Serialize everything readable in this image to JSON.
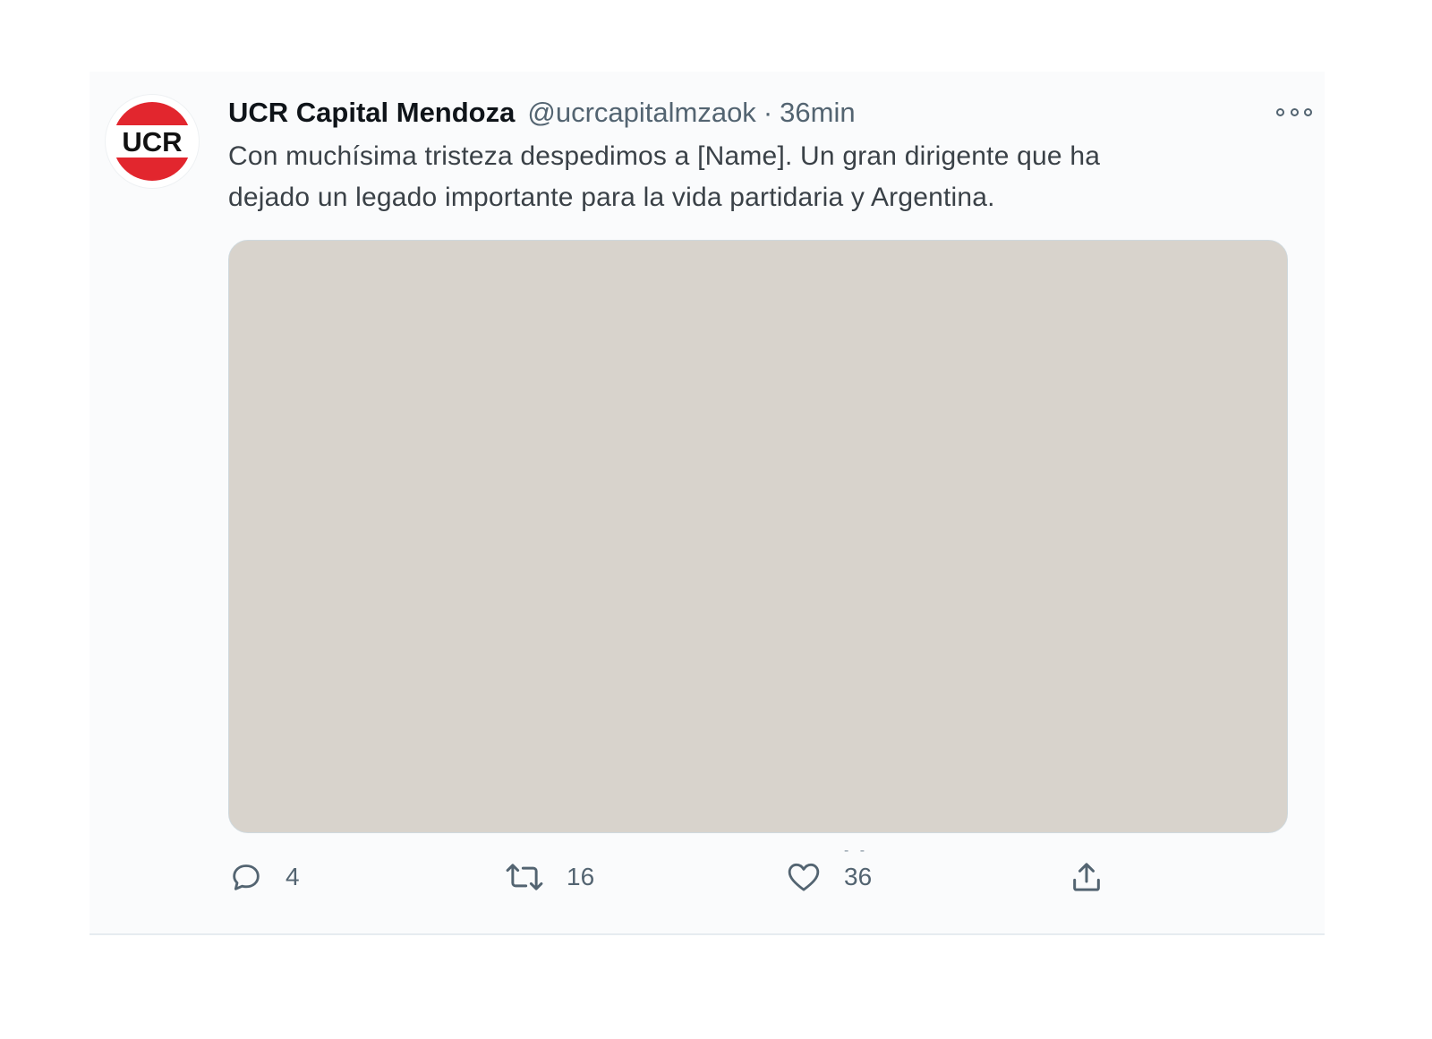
{
  "tweet": {
    "display_name": "UCR Capital Mendoza",
    "handle": "@ucrcapitalmzaok",
    "separator": "·",
    "time": "36min",
    "text_line_1": "Con muchísima tristeza despedimos a [Name]. Un gran dirigente que ha",
    "text_line_2": "dejado un legado importante para la vida partidaria y Argentina."
  },
  "avatar": {
    "logo_text": "UCR",
    "ring_color": "#e2262e"
  },
  "media": {
    "description": "photo"
  },
  "actions": {
    "reply_count": "4",
    "retweet_count": "16",
    "like_count": "36",
    "like_count_ghost": "- -"
  },
  "icons": {
    "reply": "reply-icon",
    "retweet": "retweet-icon",
    "like": "heart-icon",
    "share": "share-icon",
    "more": "more-options-icon"
  },
  "colors": {
    "secondary_text": "#536471",
    "primary_text": "#0f1419",
    "divider": "#e6ecf0"
  }
}
